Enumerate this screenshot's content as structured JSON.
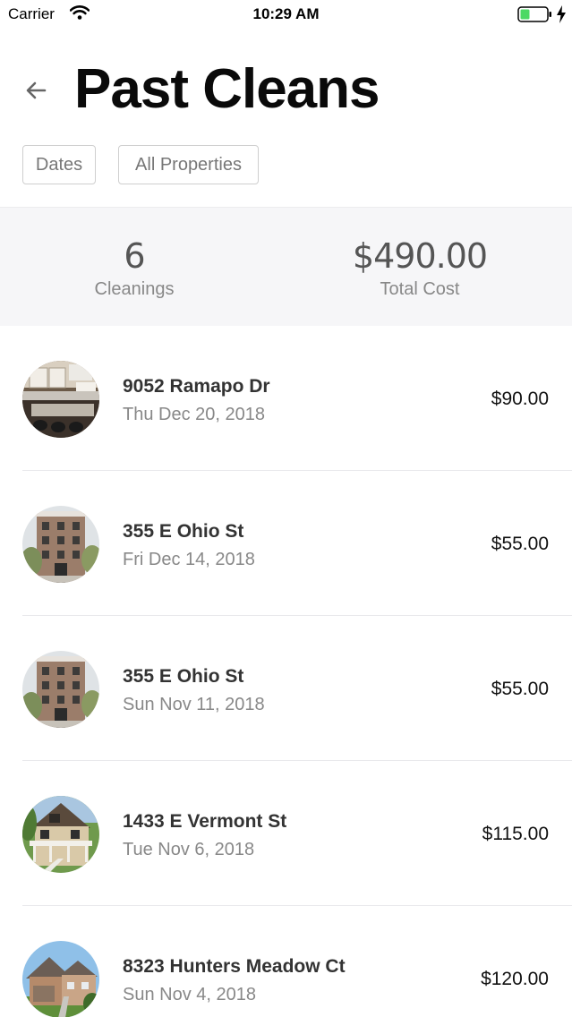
{
  "status_bar": {
    "carrier": "Carrier",
    "time": "10:29 AM"
  },
  "header": {
    "title": "Past Cleans",
    "back_icon": "arrow-left-icon"
  },
  "filters": {
    "dates_label": "Dates",
    "properties_label": "All Properties"
  },
  "summary": {
    "count_value": "6",
    "count_label": "Cleanings",
    "cost_value": "$490.00",
    "cost_label": "Total Cost"
  },
  "cleans": [
    {
      "address": "9052 Ramapo Dr",
      "date": "Thu Dec 20, 2018",
      "price": "$90.00",
      "thumb": "kitchen"
    },
    {
      "address": "355 E Ohio St",
      "date": "Fri Dec 14, 2018",
      "price": "$55.00",
      "thumb": "building"
    },
    {
      "address": "355 E Ohio St",
      "date": "Sun Nov 11, 2018",
      "price": "$55.00",
      "thumb": "building"
    },
    {
      "address": "1433 E Vermont St",
      "date": "Tue Nov 6, 2018",
      "price": "$115.00",
      "thumb": "porch-house"
    },
    {
      "address": "8323 Hunters Meadow Ct",
      "date": "Sun Nov 4, 2018",
      "price": "$120.00",
      "thumb": "suburban-house"
    }
  ],
  "colors": {
    "summary_bg": "#f6f6f8",
    "battery_green": "#4cd964",
    "chip_border": "#cfcfcf"
  }
}
